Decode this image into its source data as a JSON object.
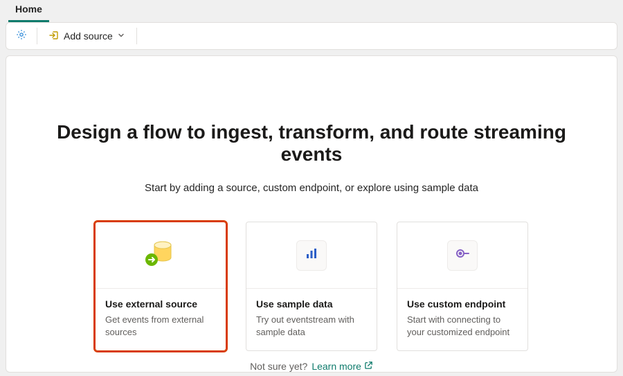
{
  "tabs": {
    "home": "Home"
  },
  "toolbar": {
    "add_source": "Add source"
  },
  "hero": {
    "title": "Design a flow to ingest, transform, and route streaming events",
    "subtitle": "Start by adding a source, custom endpoint, or explore using sample data"
  },
  "cards": {
    "external": {
      "title": "Use external source",
      "desc": "Get events from external sources"
    },
    "sample": {
      "title": "Use sample data",
      "desc": "Try out eventstream with sample data"
    },
    "custom": {
      "title": "Use custom endpoint",
      "desc": "Start with connecting to your customized endpoint"
    }
  },
  "footer": {
    "not_sure": "Not sure yet?",
    "learn_more": "Learn more"
  },
  "colors": {
    "accent": "#0f7b6c",
    "highlight": "#d83b01",
    "icon_blue": "#2b5ec7",
    "icon_purple": "#8661c5",
    "icon_green": "#6bb700",
    "icon_yellow": "#ffd55e",
    "gear": "#2b88d8",
    "add_icon": "#c19c00"
  }
}
